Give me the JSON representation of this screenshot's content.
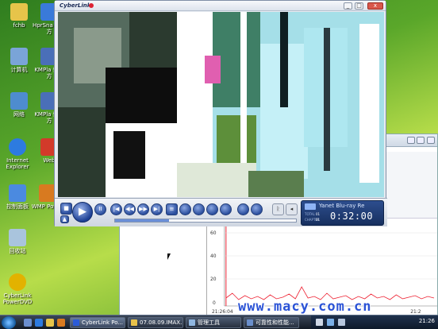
{
  "desktop": {
    "icons": [
      {
        "label": "fchb",
        "color": "#e7c44a"
      },
      {
        "label": "HprSna 快捷方",
        "color": "#3a7ad9"
      },
      {
        "label": "计算机",
        "color": "#7aa4d8"
      },
      {
        "label": "KMPla 快捷方",
        "color": "#4a6fb8"
      },
      {
        "label": "网络",
        "color": "#4e8ccf"
      },
      {
        "label": "KMPla 快捷方",
        "color": "#4a6fb8"
      },
      {
        "label": "Internet Explorer",
        "color": "#2d7be0"
      },
      {
        "label": "Web",
        "color": "#d23a2a"
      },
      {
        "label": "控制面板",
        "color": "#4b8ae0"
      },
      {
        "label": "WMP Power",
        "color": "#d87a20"
      },
      {
        "label": "回收站",
        "color": "#a9c4dd"
      },
      {
        "label": "CyberLink PowerDVD",
        "color": "#e2b200"
      }
    ]
  },
  "player": {
    "brand": "CyberLink",
    "source_label": "Yanet Blu-ray Re",
    "total_label": "TOTAL",
    "chapter_label": "CHAPTER",
    "title_value": "01",
    "chapter_value": "01",
    "time": "0:32:00",
    "progress": 0.3
  },
  "monitor": {
    "y_ticks": [
      "60",
      "40",
      "20",
      "0"
    ],
    "x_ticks": [
      "21:26:04",
      "21:2"
    ]
  },
  "taskbar": {
    "tasks": [
      {
        "label": "CyberLink Po...",
        "color": "#2b5bd8"
      },
      {
        "label": "07.08.09.IMAX...",
        "color": "#e8c24a"
      },
      {
        "label": "管理工具",
        "color": "#8fb6e0"
      },
      {
        "label": "可靠性和性能...",
        "color": "#6a8fcc"
      }
    ],
    "clock": "21:26"
  },
  "watermark": "www.macy.com.cn",
  "colors": {
    "accent": "#2b53d6",
    "lcd": "#17305f"
  }
}
